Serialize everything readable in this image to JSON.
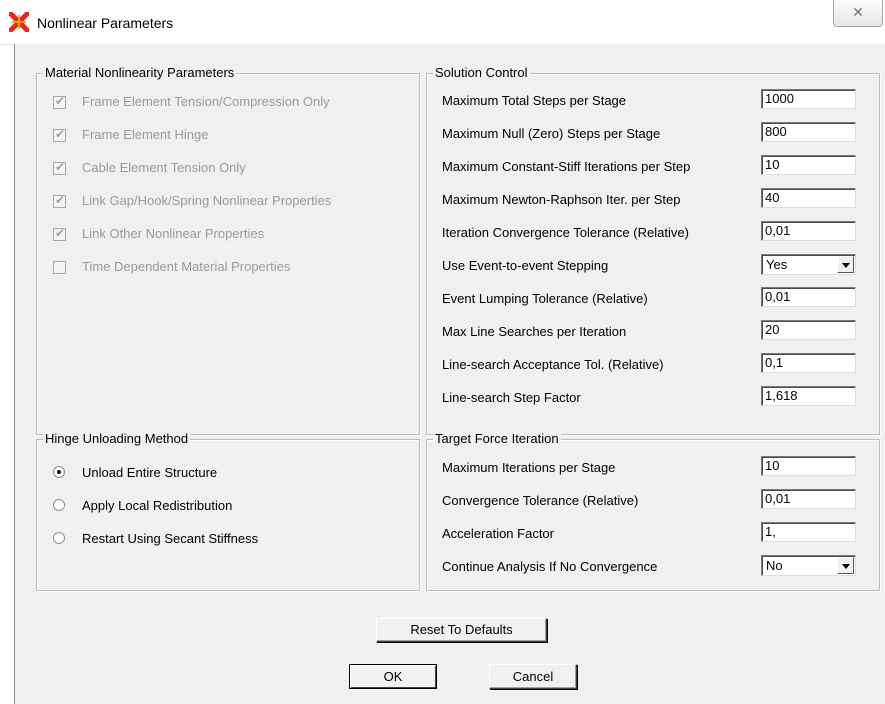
{
  "window": {
    "title": "Nonlinear Parameters",
    "close_glyph": "✕"
  },
  "material": {
    "title": "Material Nonlinearity Parameters",
    "items": [
      {
        "label": "Frame Element Tension/Compression Only",
        "checked": true
      },
      {
        "label": "Frame Element Hinge",
        "checked": true
      },
      {
        "label": "Cable Element Tension Only",
        "checked": true
      },
      {
        "label": "Link Gap/Hook/Spring Nonlinear Properties",
        "checked": true
      },
      {
        "label": "Link Other Nonlinear Properties",
        "checked": true
      },
      {
        "label": "Time Dependent Material Properties",
        "checked": false
      }
    ]
  },
  "solution": {
    "title": "Solution Control",
    "rows": [
      {
        "label": "Maximum Total Steps per Stage",
        "value": "1000"
      },
      {
        "label": "Maximum Null (Zero) Steps per Stage",
        "value": "800"
      },
      {
        "label": "Maximum Constant-Stiff Iterations per Step",
        "value": "10"
      },
      {
        "label": "Maximum Newton-Raphson Iter. per Step",
        "value": "40"
      },
      {
        "label": "Iteration Convergence Tolerance (Relative)",
        "value": "0,01"
      },
      {
        "label": "Use Event-to-event Stepping",
        "value": "Yes"
      },
      {
        "label": "Event Lumping Tolerance (Relative)",
        "value": "0,01"
      },
      {
        "label": "Max Line Searches per Iteration",
        "value": "20"
      },
      {
        "label": "Line-search Acceptance Tol. (Relative)",
        "value": "0,1"
      },
      {
        "label": "Line-search Step Factor",
        "value": "1,618"
      }
    ]
  },
  "hinge": {
    "title": "Hinge Unloading Method",
    "options": [
      {
        "label": "Unload Entire Structure",
        "selected": true
      },
      {
        "label": "Apply Local Redistribution",
        "selected": false
      },
      {
        "label": "Restart Using Secant Stiffness",
        "selected": false
      }
    ]
  },
  "target": {
    "title": "Target Force Iteration",
    "rows": [
      {
        "label": "Maximum Iterations per Stage",
        "value": "10"
      },
      {
        "label": "Convergence Tolerance (Relative)",
        "value": "0,01"
      },
      {
        "label": "Acceleration Factor",
        "value": "1,"
      },
      {
        "label": "Continue Analysis If No Convergence",
        "value": "No"
      }
    ]
  },
  "buttons": {
    "reset": "Reset To Defaults",
    "ok": "OK",
    "cancel": "Cancel"
  },
  "colors": {
    "app_icon": "#e8261c",
    "dialog_face": "#f0f0f0",
    "disabled_text": "#9a9a9a"
  }
}
